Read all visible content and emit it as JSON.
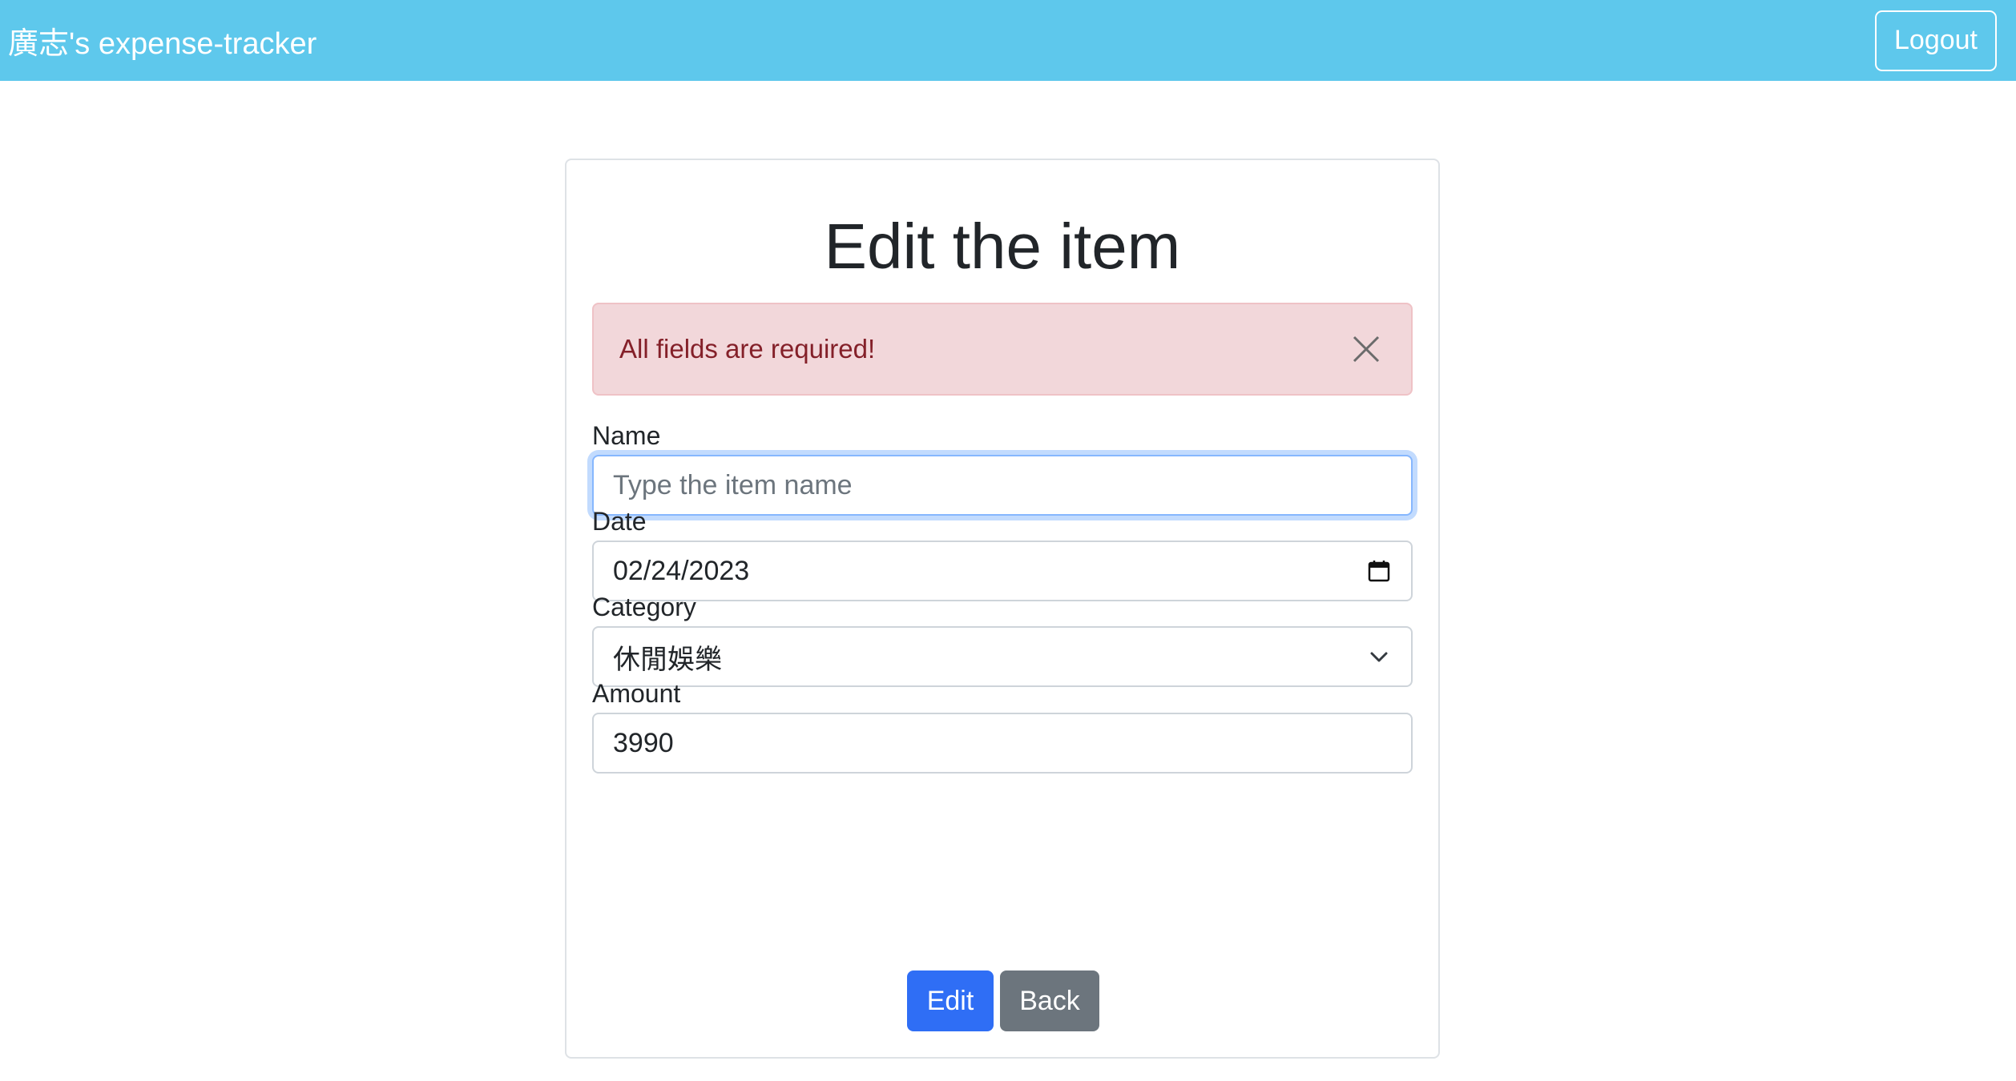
{
  "navbar": {
    "brand": "廣志's expense-tracker",
    "logout_label": "Logout"
  },
  "form": {
    "title": "Edit the item",
    "alert": {
      "message": "All fields are required!",
      "close_icon": "close-icon"
    },
    "name": {
      "label": "Name",
      "placeholder": "Type the item name",
      "value": ""
    },
    "date": {
      "label": "Date",
      "value": "02/24/2023",
      "icon": "calendar-icon"
    },
    "category": {
      "label": "Category",
      "selected": "休閒娛樂",
      "icon": "chevron-down-icon"
    },
    "amount": {
      "label": "Amount",
      "value": "3990"
    },
    "buttons": {
      "edit_label": "Edit",
      "back_label": "Back"
    }
  },
  "colors": {
    "navbar_bg": "#5ec8ec",
    "primary": "#2f6ef5",
    "secondary": "#6c757d",
    "alert_bg": "#f2d7da",
    "alert_text": "#842029"
  }
}
